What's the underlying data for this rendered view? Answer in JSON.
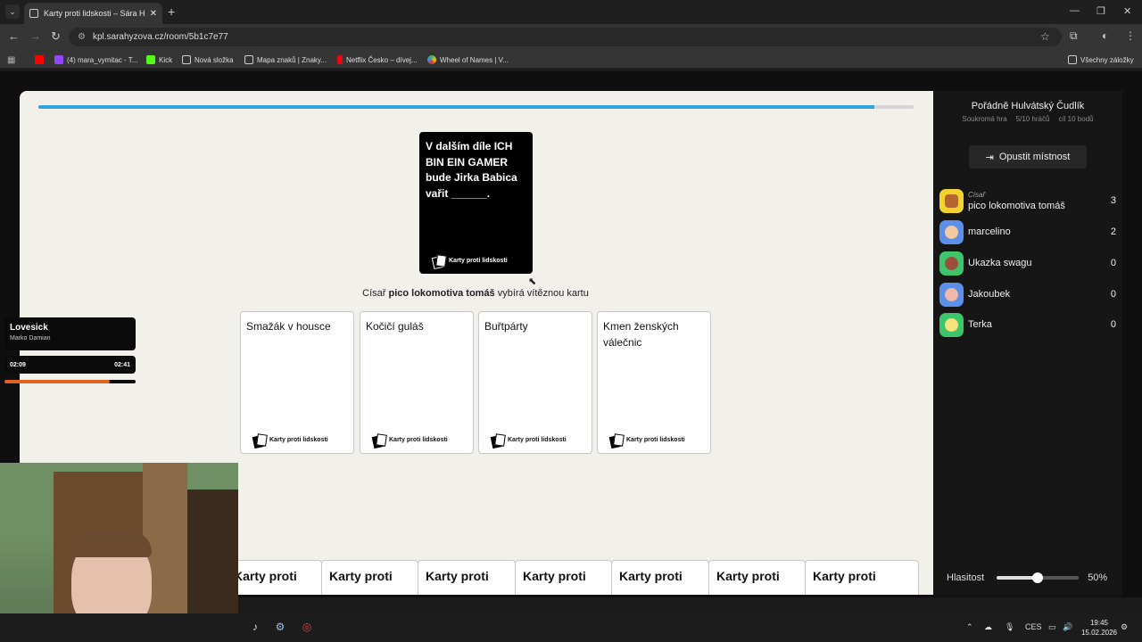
{
  "browser": {
    "tab_title": "Karty proti lidskosti – Sára Hyžová",
    "url": "kpl.sarahyzova.cz/room/5b1c7e77",
    "bookmarks": [
      {
        "label": "",
        "color": "#ff0000"
      },
      {
        "label": "(4) mara_vymitac - T...",
        "color": "#9146ff"
      },
      {
        "label": "Kick",
        "color": "#53fc18"
      },
      {
        "label": "Nová složka",
        "color": "#cccccc"
      },
      {
        "label": "Mapa znaků | Znaky...",
        "color": "#cccccc"
      },
      {
        "label": "Netflix Česko – dívej...",
        "color": "#e50914"
      },
      {
        "label": "Wheel of Names | V...",
        "color": "#3cba54"
      }
    ],
    "all_bookmarks": "Všechny záložky"
  },
  "game": {
    "progress": 0.955,
    "black_card_text": "V dalším díle ICH BIN EIN GAMER bude Jirka Babica vařit ______.",
    "brand": "Karty proti lidskosti",
    "czar_prefix": "Císař",
    "czar_name": "pico lokomotiva tomáš",
    "czar_suffix": "vybírá vítěznou kartu",
    "played_cards": [
      "Smažák v housce",
      "Kočičí guláš",
      "Buřtpárty",
      "Kmen ženských válečnic"
    ],
    "hand_cards": [
      "Karty proti",
      "Karty proti",
      "Karty proti",
      "Karty proti",
      "Karty proti",
      "Karty proti",
      "Karty proti"
    ]
  },
  "sidebar": {
    "room_name": "Pořádně Hulvátský Čudlík",
    "room_type": "Soukromá hra",
    "players_count": "5/10 hráčů",
    "goal": "cíl 10 bodů",
    "leave_label": "Opustit místnost",
    "czar_role": "Císař",
    "players": [
      {
        "name": "pico lokomotiva tomáš",
        "score": "3",
        "color": "#f2d22e"
      },
      {
        "name": "marcelino",
        "score": "2",
        "color": "#5b8fe8"
      },
      {
        "name": "Ukazka swagu",
        "score": "0",
        "color": "#3ec46a"
      },
      {
        "name": "Jakoubek",
        "score": "0",
        "color": "#5b8fe8"
      },
      {
        "name": "Terka",
        "score": "0",
        "color": "#3ec46a"
      }
    ],
    "volume_label": "Hlasitost",
    "volume_value": "50%",
    "volume": 0.5
  },
  "music": {
    "title": "Lovesick",
    "artist": "Marko Damian",
    "elapsed": "02:09",
    "total": "02:41",
    "progress": 0.8
  },
  "taskbar": {
    "language": "CES",
    "time": "19:45",
    "date": "15.02.2026"
  }
}
